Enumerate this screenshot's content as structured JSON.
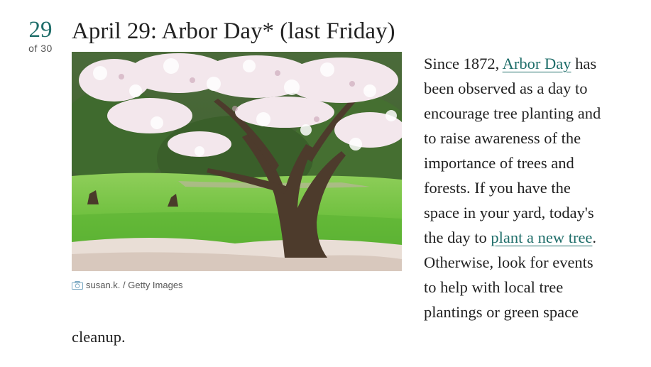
{
  "counter": {
    "number": "29",
    "of_label": "of 30"
  },
  "title": "April 29: Arbor Day* (last Friday)",
  "figure": {
    "caption": "susan.k. / Getty Images",
    "icon": "camera-icon"
  },
  "body": {
    "part1": "Since 1872, ",
    "link1": "Arbor Day",
    "part2": " has been observed as a day to encourage tree planting and to raise awareness of the importance of trees and forests. If you have the space in your yard, today's the day to ",
    "link2": "plant a new tree",
    "part3": ". Otherwise, look for events to help with local tree plantings or green space cleanup."
  },
  "colors": {
    "accent": "#1f6e6a",
    "text": "#222222",
    "muted": "#555555"
  }
}
